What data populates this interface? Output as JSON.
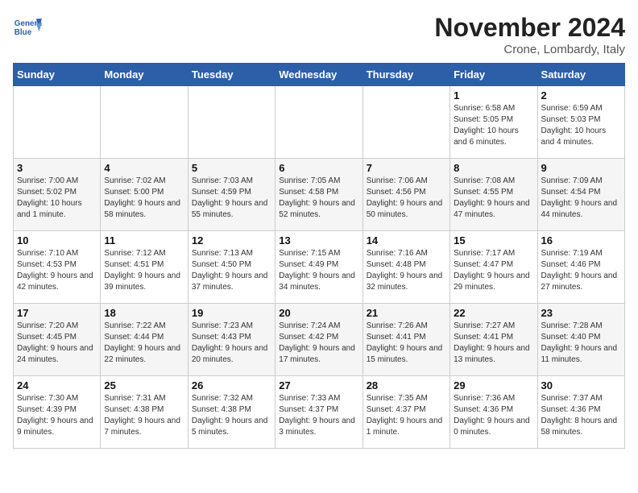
{
  "header": {
    "logo_line1": "General",
    "logo_line2": "Blue",
    "month": "November 2024",
    "location": "Crone, Lombardy, Italy"
  },
  "weekdays": [
    "Sunday",
    "Monday",
    "Tuesday",
    "Wednesday",
    "Thursday",
    "Friday",
    "Saturday"
  ],
  "weeks": [
    [
      {
        "day": "",
        "info": ""
      },
      {
        "day": "",
        "info": ""
      },
      {
        "day": "",
        "info": ""
      },
      {
        "day": "",
        "info": ""
      },
      {
        "day": "",
        "info": ""
      },
      {
        "day": "1",
        "info": "Sunrise: 6:58 AM\nSunset: 5:05 PM\nDaylight: 10 hours and 6 minutes."
      },
      {
        "day": "2",
        "info": "Sunrise: 6:59 AM\nSunset: 5:03 PM\nDaylight: 10 hours and 4 minutes."
      }
    ],
    [
      {
        "day": "3",
        "info": "Sunrise: 7:00 AM\nSunset: 5:02 PM\nDaylight: 10 hours and 1 minute."
      },
      {
        "day": "4",
        "info": "Sunrise: 7:02 AM\nSunset: 5:00 PM\nDaylight: 9 hours and 58 minutes."
      },
      {
        "day": "5",
        "info": "Sunrise: 7:03 AM\nSunset: 4:59 PM\nDaylight: 9 hours and 55 minutes."
      },
      {
        "day": "6",
        "info": "Sunrise: 7:05 AM\nSunset: 4:58 PM\nDaylight: 9 hours and 52 minutes."
      },
      {
        "day": "7",
        "info": "Sunrise: 7:06 AM\nSunset: 4:56 PM\nDaylight: 9 hours and 50 minutes."
      },
      {
        "day": "8",
        "info": "Sunrise: 7:08 AM\nSunset: 4:55 PM\nDaylight: 9 hours and 47 minutes."
      },
      {
        "day": "9",
        "info": "Sunrise: 7:09 AM\nSunset: 4:54 PM\nDaylight: 9 hours and 44 minutes."
      }
    ],
    [
      {
        "day": "10",
        "info": "Sunrise: 7:10 AM\nSunset: 4:53 PM\nDaylight: 9 hours and 42 minutes."
      },
      {
        "day": "11",
        "info": "Sunrise: 7:12 AM\nSunset: 4:51 PM\nDaylight: 9 hours and 39 minutes."
      },
      {
        "day": "12",
        "info": "Sunrise: 7:13 AM\nSunset: 4:50 PM\nDaylight: 9 hours and 37 minutes."
      },
      {
        "day": "13",
        "info": "Sunrise: 7:15 AM\nSunset: 4:49 PM\nDaylight: 9 hours and 34 minutes."
      },
      {
        "day": "14",
        "info": "Sunrise: 7:16 AM\nSunset: 4:48 PM\nDaylight: 9 hours and 32 minutes."
      },
      {
        "day": "15",
        "info": "Sunrise: 7:17 AM\nSunset: 4:47 PM\nDaylight: 9 hours and 29 minutes."
      },
      {
        "day": "16",
        "info": "Sunrise: 7:19 AM\nSunset: 4:46 PM\nDaylight: 9 hours and 27 minutes."
      }
    ],
    [
      {
        "day": "17",
        "info": "Sunrise: 7:20 AM\nSunset: 4:45 PM\nDaylight: 9 hours and 24 minutes."
      },
      {
        "day": "18",
        "info": "Sunrise: 7:22 AM\nSunset: 4:44 PM\nDaylight: 9 hours and 22 minutes."
      },
      {
        "day": "19",
        "info": "Sunrise: 7:23 AM\nSunset: 4:43 PM\nDaylight: 9 hours and 20 minutes."
      },
      {
        "day": "20",
        "info": "Sunrise: 7:24 AM\nSunset: 4:42 PM\nDaylight: 9 hours and 17 minutes."
      },
      {
        "day": "21",
        "info": "Sunrise: 7:26 AM\nSunset: 4:41 PM\nDaylight: 9 hours and 15 minutes."
      },
      {
        "day": "22",
        "info": "Sunrise: 7:27 AM\nSunset: 4:41 PM\nDaylight: 9 hours and 13 minutes."
      },
      {
        "day": "23",
        "info": "Sunrise: 7:28 AM\nSunset: 4:40 PM\nDaylight: 9 hours and 11 minutes."
      }
    ],
    [
      {
        "day": "24",
        "info": "Sunrise: 7:30 AM\nSunset: 4:39 PM\nDaylight: 9 hours and 9 minutes."
      },
      {
        "day": "25",
        "info": "Sunrise: 7:31 AM\nSunset: 4:38 PM\nDaylight: 9 hours and 7 minutes."
      },
      {
        "day": "26",
        "info": "Sunrise: 7:32 AM\nSunset: 4:38 PM\nDaylight: 9 hours and 5 minutes."
      },
      {
        "day": "27",
        "info": "Sunrise: 7:33 AM\nSunset: 4:37 PM\nDaylight: 9 hours and 3 minutes."
      },
      {
        "day": "28",
        "info": "Sunrise: 7:35 AM\nSunset: 4:37 PM\nDaylight: 9 hours and 1 minute."
      },
      {
        "day": "29",
        "info": "Sunrise: 7:36 AM\nSunset: 4:36 PM\nDaylight: 9 hours and 0 minutes."
      },
      {
        "day": "30",
        "info": "Sunrise: 7:37 AM\nSunset: 4:36 PM\nDaylight: 8 hours and 58 minutes."
      }
    ]
  ]
}
